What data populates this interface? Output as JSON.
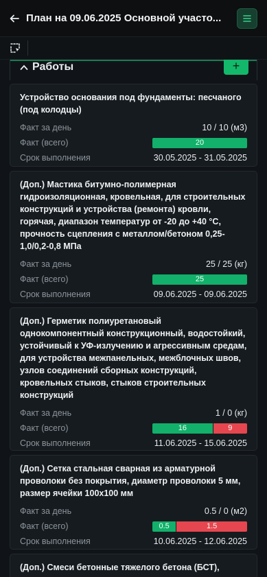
{
  "header": {
    "title": "План на 09.06.2025 Основной участо..."
  },
  "section": {
    "title": "Работы",
    "add_label": "+"
  },
  "labels": {
    "fact_day": "Факт за день",
    "fact_total": "Факт (всего)",
    "deadline": "Срок выполнения"
  },
  "cards": [
    {
      "title": "Устройство основания под фундаменты: песчаного (под колодцы)",
      "fact_day": "10 / 10 (м3)",
      "fact_total_segments": [
        {
          "label": "20",
          "fraction": 1.0,
          "color": "#12b06a"
        }
      ],
      "deadline": "30.05.2025 - 31.05.2025"
    },
    {
      "title": "(Доп.) Мастика битумно-полимерная гидроизоляционная, кровельная, для строительных конструкций и устройства (ремонта) кровли, горячая, диапазон температур от -20 до +40 °С, прочность сцепления с металлом/бетоном 0,25-1,0/0,2-0,8 МПа",
      "fact_day": "25 / 25 (кг)",
      "fact_total_segments": [
        {
          "label": "25",
          "fraction": 1.0,
          "color": "#12b06a"
        }
      ],
      "deadline": "09.06.2025 - 09.06.2025"
    },
    {
      "title": "(Доп.) Герметик полиуретановый однокомпонентный конструкционный, водостойкий, устойчивый к УФ-излучению и агрессивным средам, для устройства межпанельных, межблочных швов, узлов соединений сборных конструкций, кровельных стыков, стыков строительных конструкций",
      "fact_day": "1 / 0 (кг)",
      "fact_total_segments": [
        {
          "label": "16",
          "fraction": 0.64,
          "color": "#12b06a"
        },
        {
          "label": "9",
          "fraction": 0.36,
          "color": "#e6464f"
        }
      ],
      "deadline": "11.06.2025 - 15.06.2025"
    },
    {
      "title": "(Доп.) Сетка стальная сварная из арматурной проволоки без покрытия, диаметр проволоки 5 мм, размер ячейки 100х100 мм",
      "fact_day": "0.5 / 0 (м2)",
      "fact_total_segments": [
        {
          "label": "0.5",
          "fraction": 0.25,
          "color": "#12b06a"
        },
        {
          "label": "1.5",
          "fraction": 0.75,
          "color": "#e6464f"
        }
      ],
      "deadline": "10.06.2025 - 12.06.2025"
    },
    {
      "title": "(Доп.) Смеси бетонные тяжелого бетона (БСТ),"
    }
  ]
}
